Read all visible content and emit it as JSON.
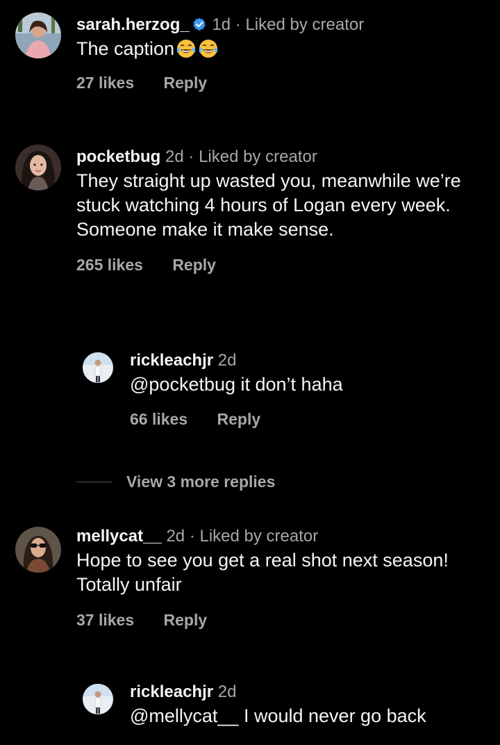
{
  "comments": [
    {
      "username": "sarah.herzog_",
      "verified": true,
      "time": "1d",
      "liked_by": "Liked by creator",
      "text": "The caption",
      "emoji": "😂😂",
      "likes": "27 likes",
      "reply_label": "Reply"
    },
    {
      "username": "pocketbug",
      "time": "2d",
      "liked_by": "Liked by creator",
      "text": "They straight up wasted you, meanwhile we’re stuck watching 4 hours of Logan every week. Someone make it make sense.",
      "likes": "265 likes",
      "reply_label": "Reply"
    },
    {
      "username": "rickleachjr",
      "time": "2d",
      "text": "@pocketbug it don’t haha",
      "likes": "66 likes",
      "reply_label": "Reply"
    },
    {
      "username": "mellycat__",
      "time": "2d",
      "liked_by": "Liked by creator",
      "text": "Hope to see you get a real shot next season! Totally unfair",
      "likes": "37 likes",
      "reply_label": "Reply"
    },
    {
      "username": "rickleachjr",
      "time": "2d",
      "text": "@mellycat__ I would never go back"
    }
  ],
  "view_more_replies": "View 3 more replies",
  "separator": "·",
  "colors": {
    "background": "#000000",
    "primary_text": "#f5f5f5",
    "secondary_text": "#a8a8a8",
    "verified_badge": "#3897f0"
  },
  "icons": {
    "verified": "verified-badge-icon",
    "emoji": "face-with-tears-of-joy-icon"
  }
}
